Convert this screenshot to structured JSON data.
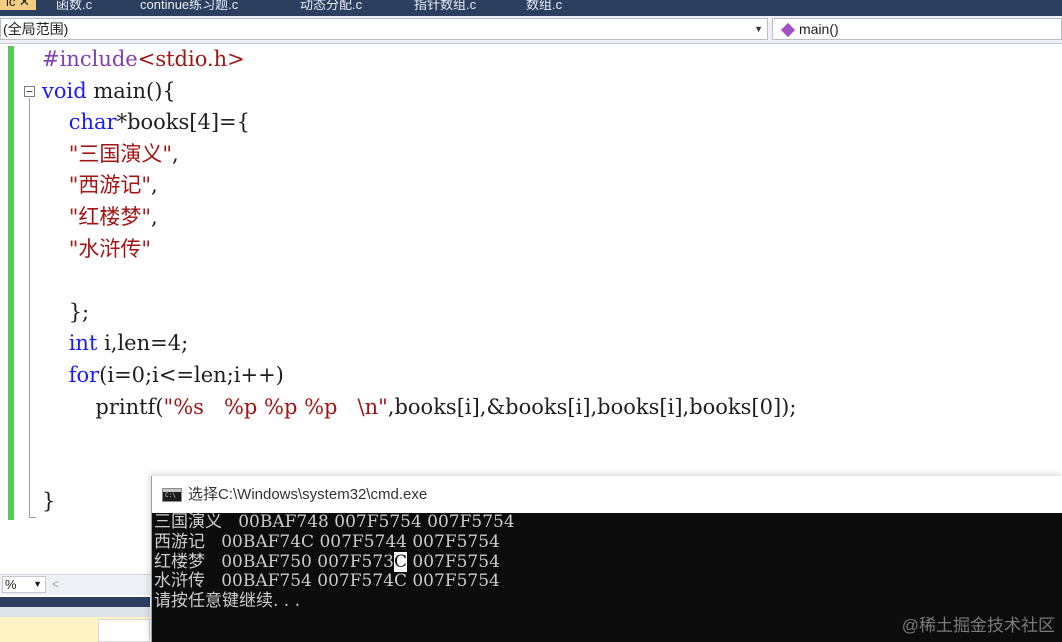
{
  "tabs": [
    {
      "label": "ic",
      "active": true
    },
    {
      "label": "✕",
      "active": true
    },
    {
      "label": "函数.c",
      "active": false
    },
    {
      "label": "continue练习题.c",
      "active": false
    },
    {
      "label": "动态分配.c",
      "active": false
    },
    {
      "label": "指针数组.c",
      "active": false
    },
    {
      "label": "数组.c",
      "active": false
    }
  ],
  "scope": {
    "left": "(全局范围)",
    "right": "main()"
  },
  "code": {
    "line1": {
      "pre": "#include",
      "inc": "<stdio.h>"
    },
    "line2": {
      "kw": "void",
      "rest": " main(){"
    },
    "line3": {
      "indent": "    ",
      "kw": "char",
      "rest": "*books[4]={"
    },
    "line4": {
      "indent": "    ",
      "str": "\"三国演义\"",
      "rest": ","
    },
    "line5": {
      "indent": "    ",
      "str": "\"西游记\"",
      "rest": ","
    },
    "line6": {
      "indent": "    ",
      "str": "\"红楼梦\"",
      "rest": ","
    },
    "line7": {
      "indent": "    ",
      "str": "\"水浒传\"",
      "rest": ""
    },
    "line8": {
      "text": ""
    },
    "line9": {
      "text": "    };"
    },
    "line10": {
      "indent": "    ",
      "kw": "int",
      "rest": " i,len=4;"
    },
    "line11": {
      "indent": "    ",
      "kw": "for",
      "rest": "(i=0;i<=len;i++)"
    },
    "line12": {
      "indent": "        ",
      "pre": "printf(",
      "str": "\"%s   %p %p %p   \\n\"",
      "rest": ",books[i],&books[i],books[i],books[0]);"
    },
    "line13": {
      "text": ""
    },
    "line14": {
      "text": ""
    },
    "line15": {
      "text": "}"
    }
  },
  "zoom": {
    "value": "%"
  },
  "console": {
    "title": "选择C:\\Windows\\system32\\cmd.exe",
    "lines": [
      "三国演义   00BAF748 007F5754 007F5754",
      "西游记   00BAF74C 007F5744 007F5754",
      {
        "before": "红楼梦   00BAF750 007F573",
        "cursor": "C",
        "after": " 007F5754"
      },
      "水浒传   00BAF754 007F574C 007F5754",
      "请按任意键继续. . ."
    ]
  },
  "watermark": "@稀土掘金技术社区"
}
